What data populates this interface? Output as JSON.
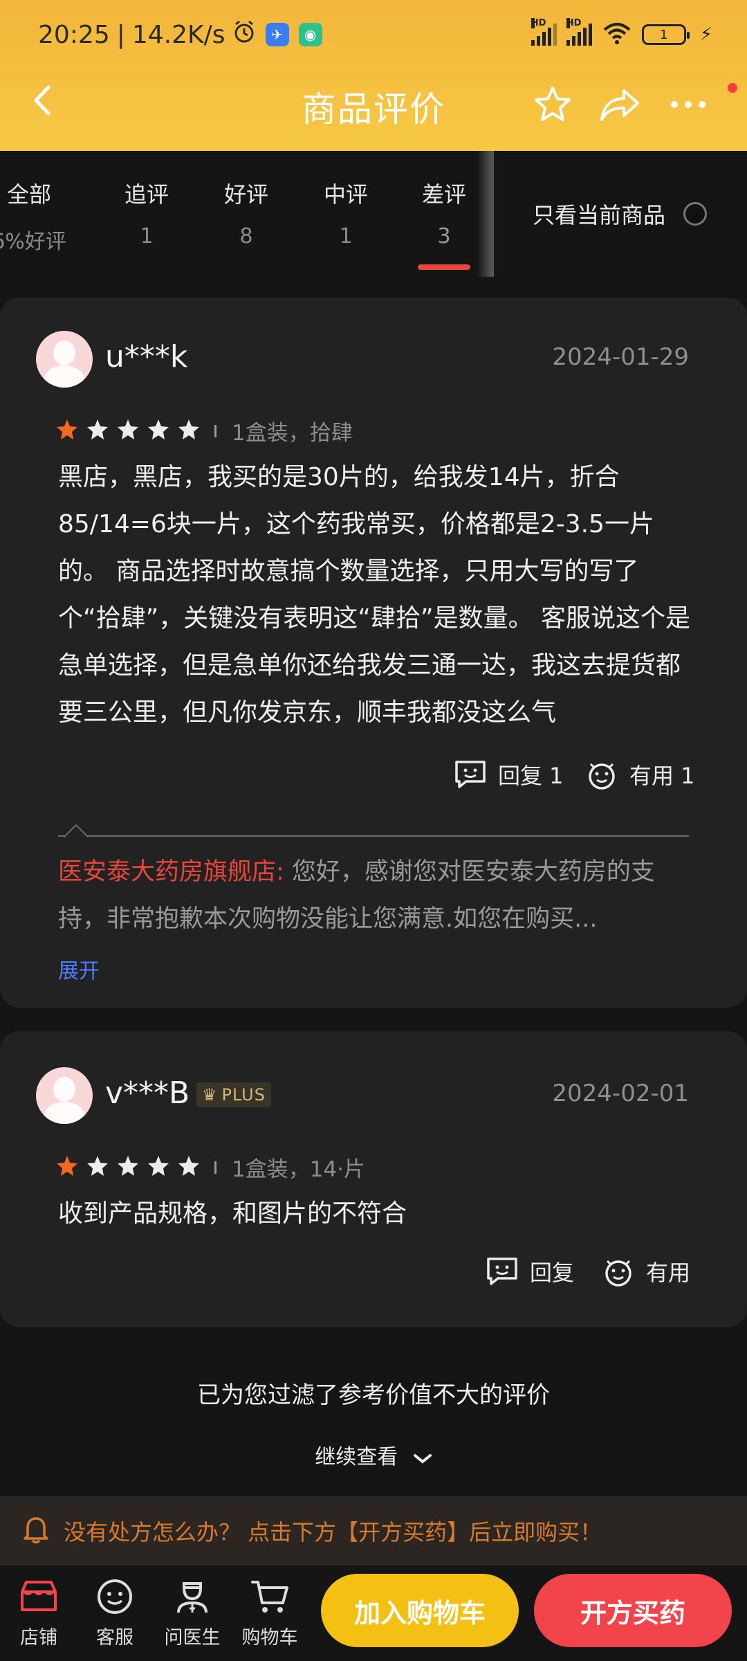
{
  "status": {
    "time": "20:25",
    "speed": "14.2K/s",
    "battery": "1",
    "signal_label": "HD"
  },
  "nav": {
    "title": "商品评价"
  },
  "tabs": [
    {
      "label": "全部",
      "sub": "6%好评"
    },
    {
      "label": "追评",
      "sub": "1"
    },
    {
      "label": "好评",
      "sub": "8"
    },
    {
      "label": "中评",
      "sub": "1"
    },
    {
      "label": "差评",
      "sub": "3"
    }
  ],
  "only_current": "只看当前商品",
  "reviews": [
    {
      "user": "u***k",
      "date": "2024-01-29",
      "rating": 1,
      "spec": "1盒装，拾肆",
      "content": "黑店，黑店，我买的是30片的，给我发14片，折合85/14=6块一片，这个药我常买，价格都是2-3.5一片的。 商品选择时故意搞个数量选择，只用大写的写了个“拾肆”，关键没有表明这“肆拾”是数量。 客服说这个是急单选择，但是急单你还给我发三通一达，我这去提货都要三公里，但凡你发京东，顺丰我都没这么气",
      "reply_label": "回复 1",
      "useful_label": "有用 1",
      "shop_name": "医安泰大药房旗舰店:",
      "shop_reply": " 您好，感谢您对医安泰大药房的支持，非常抱歉本次购物没能让您满意.如您在购买...",
      "expand": "展开"
    },
    {
      "user": "v***B",
      "badge": "PLUS",
      "date": "2024-02-01",
      "rating": 1,
      "spec": "1盒装，14·片",
      "content": "收到产品规格，和图片的不符合",
      "reply_label": "回复",
      "useful_label": "有用"
    }
  ],
  "filtered_text": "已为您过滤了参考价值不大的评价",
  "more_text": "继续查看",
  "banner": "没有处方怎么办？ 点击下方【开方买药】后立即购买！",
  "bottom": {
    "store": "店铺",
    "service": "客服",
    "doctor": "问医生",
    "cart": "购物车",
    "add_cart": "加入购物车",
    "prescribe": "开方买药"
  },
  "colors": {
    "header": "#f5c040",
    "accent_red": "#e8453b",
    "cart_btn": "#f3c013",
    "rx_btn": "#f2454b",
    "star_active": "#f26a21"
  }
}
